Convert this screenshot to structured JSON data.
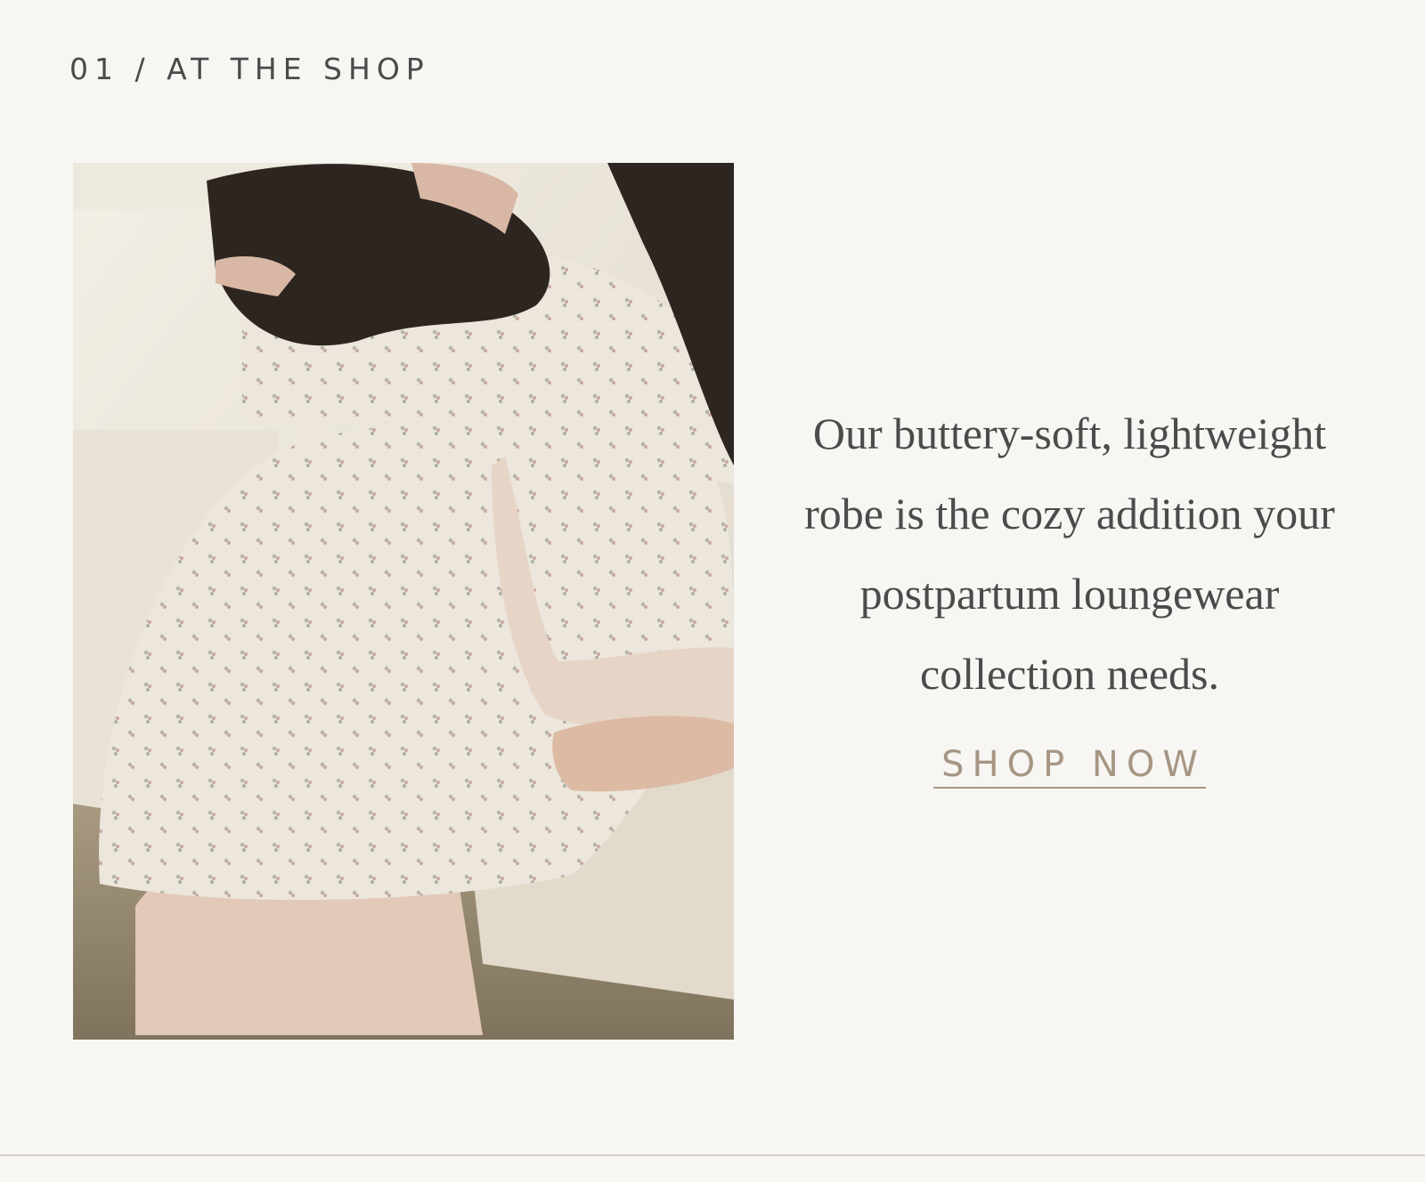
{
  "section": {
    "eyebrow": "01 / AT THE SHOP"
  },
  "feature": {
    "image_subject": "lifestyle-photo-robe",
    "body": "Our buttery-soft, lightweight robe is the cozy addition your postpartum loungewear collection needs.",
    "cta_label": "SHOP NOW"
  },
  "colors": {
    "background": "#f7f6f3",
    "text": "#4b4b4b",
    "accent": "#a79684",
    "divider": "#d8cfc4"
  }
}
